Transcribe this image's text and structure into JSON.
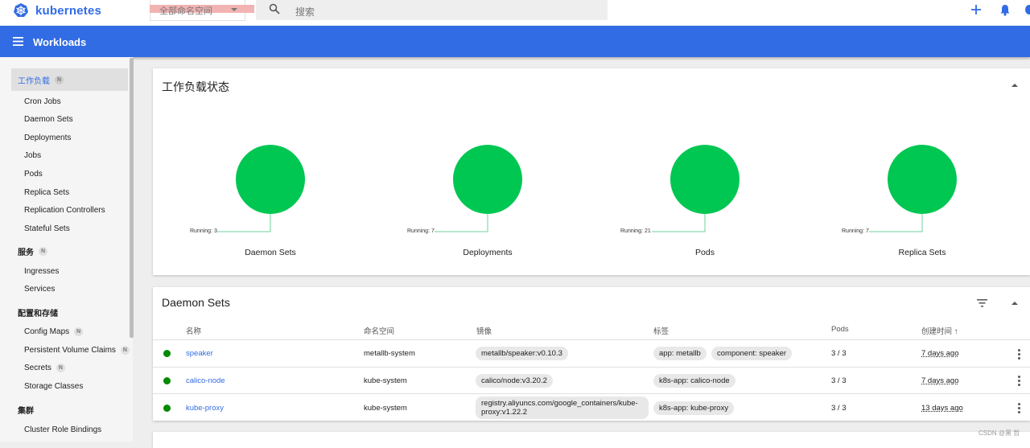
{
  "topbar": {
    "logo_text": "kubernetes",
    "namespace": "全部命名空间",
    "search_placeholder": "搜索"
  },
  "appbar": {
    "title": "Workloads"
  },
  "sidebar": {
    "workloads": {
      "label": "工作负载",
      "badge": "N"
    },
    "workload_items": [
      "Cron Jobs",
      "Daemon Sets",
      "Deployments",
      "Jobs",
      "Pods",
      "Replica Sets",
      "Replication Controllers",
      "Stateful Sets"
    ],
    "services": {
      "label": "服务",
      "badge": "N"
    },
    "service_items": [
      "Ingresses",
      "Services"
    ],
    "config": {
      "label": "配置和存储"
    },
    "config_items": [
      {
        "label": "Config Maps",
        "badge": "N"
      },
      {
        "label": "Persistent Volume Claims",
        "badge": "N"
      },
      {
        "label": "Secrets",
        "badge": "N"
      },
      {
        "label": "Storage Classes"
      }
    ],
    "cluster": {
      "label": "集群"
    },
    "cluster_items": [
      "Cluster Role Bindings"
    ]
  },
  "status_card": {
    "title": "工作负载状态",
    "charts": [
      {
        "name": "Daemon Sets",
        "running": "Running: 3",
        "value": 3
      },
      {
        "name": "Deployments",
        "running": "Running: 7",
        "value": 7
      },
      {
        "name": "Pods",
        "running": "Running: 21",
        "value": 21
      },
      {
        "name": "Replica Sets",
        "running": "Running: 7",
        "value": 7
      }
    ],
    "running_color": "#00c752"
  },
  "ds_card": {
    "title": "Daemon Sets",
    "headers": {
      "name": "名称",
      "namespace": "命名空间",
      "image": "镜像",
      "labels": "标签",
      "pods": "Pods",
      "created": "创建时间"
    },
    "rows": [
      {
        "name": "speaker",
        "namespace": "metallb-system",
        "image": "metallb/speaker:v0.10.3",
        "labels": [
          "app: metallb",
          "component: speaker"
        ],
        "pods": "3 / 3",
        "age": "7 days ago"
      },
      {
        "name": "calico-node",
        "namespace": "kube-system",
        "image": "calico/node:v3.20.2",
        "labels": [
          "k8s-app: calico-node"
        ],
        "pods": "3 / 3",
        "age": "7 days ago"
      },
      {
        "name": "kube-proxy",
        "namespace": "kube-system",
        "image_line1": "registry.aliyuncs.com/google_containers/kube-",
        "image_line2": "proxy:v1.22.2",
        "labels": [
          "k8s-app: kube-proxy"
        ],
        "pods": "3 / 3",
        "age": "13 days ago"
      }
    ]
  },
  "watermark": "CSDN @黑 哲"
}
